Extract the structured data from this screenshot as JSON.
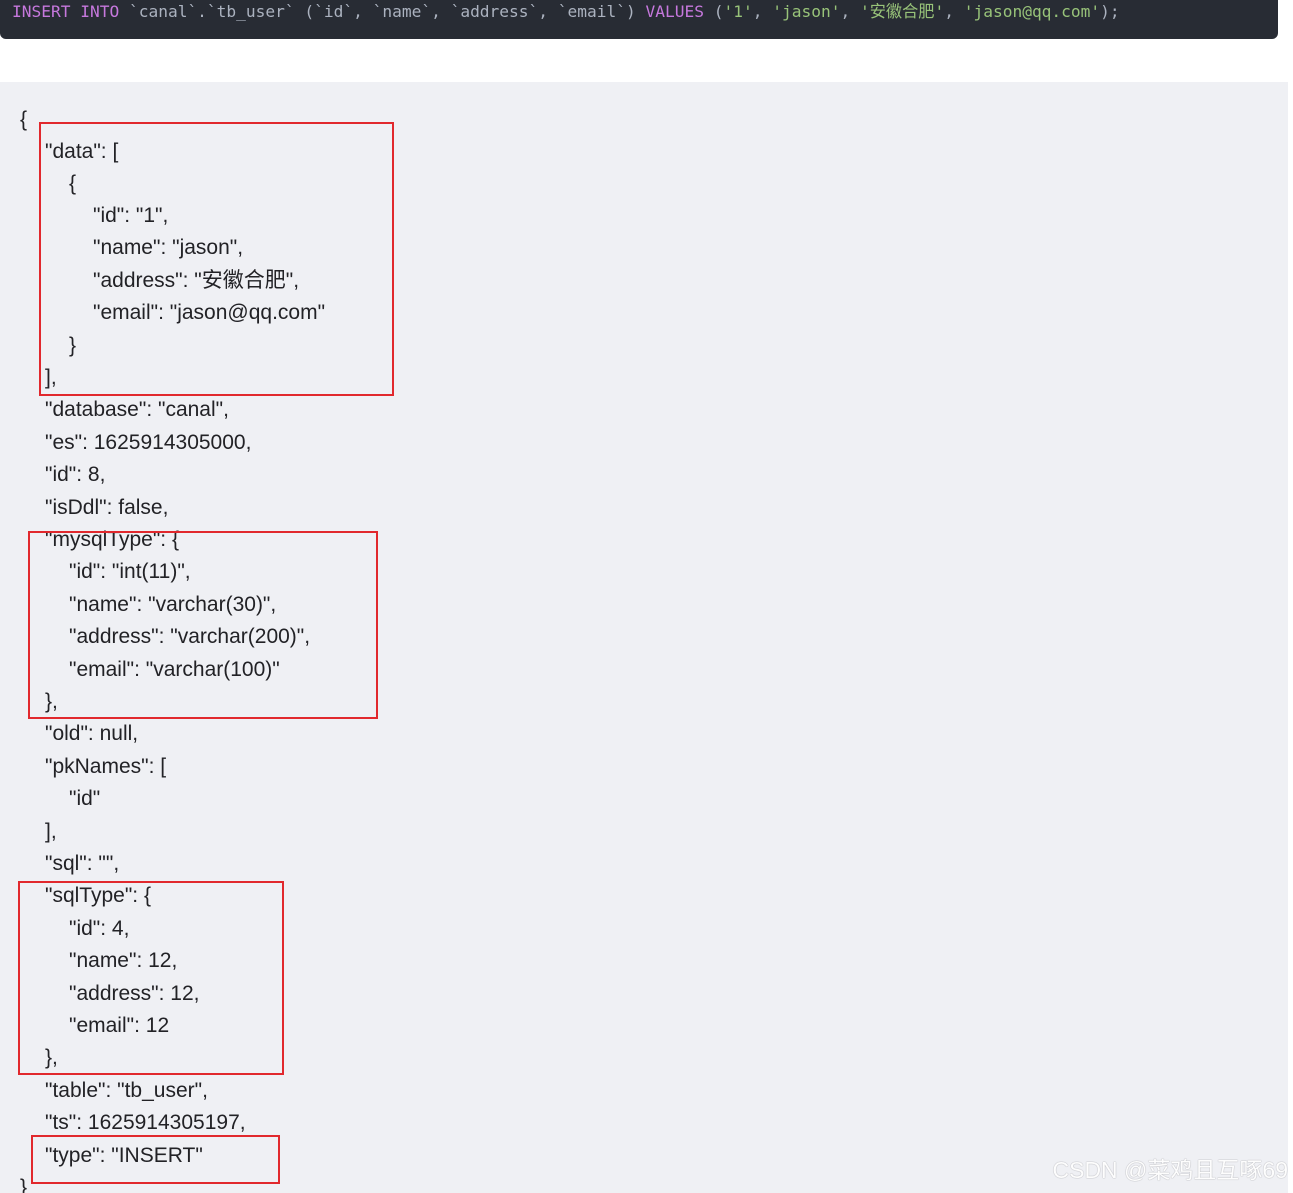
{
  "sql_statement": {
    "keyword_insert": "INSERT",
    "keyword_into": "INTO",
    "target": " `canal`.`tb_user` (`id`, `name`, `address`, `email`) ",
    "keyword_values": "VALUES",
    "open_paren": " (",
    "values": [
      "'1'",
      "'jason'",
      "'安徽合肥'",
      "'jason@qq.com'"
    ],
    "separator": ", ",
    "close_paren": ");"
  },
  "json_lines": [
    "{",
    "\"data\": [",
    "{",
    "\"id\": \"1\",",
    "\"name\": \"jason\",",
    "\"address\": \"安徽合肥\",",
    "\"email\": \"jason@qq.com\"",
    "}",
    "],",
    "\"database\": \"canal\",",
    "\"es\": 1625914305000,",
    "\"id\": 8,",
    "\"isDdl\": false,",
    "\"mysqlType\": {",
    "\"id\": \"int(11)\",",
    "\"name\": \"varchar(30)\",",
    "\"address\": \"varchar(200)\",",
    "\"email\": \"varchar(100)\"",
    "},",
    "\"old\": null,",
    "\"pkNames\": [",
    "\"id\"",
    "],",
    "\"sql\": \"\",",
    "\"sqlType\": {",
    "\"id\": 4,",
    "\"name\": 12,",
    "\"address\": 12,",
    "\"email\": 12",
    "},",
    "\"table\": \"tb_user\",",
    "\"ts\": 1625914305197,",
    "\"type\": \"INSERT\"",
    "}"
  ],
  "highlight_color": "#e1282d",
  "watermark": "CSDN @菜鸡且互啄69"
}
